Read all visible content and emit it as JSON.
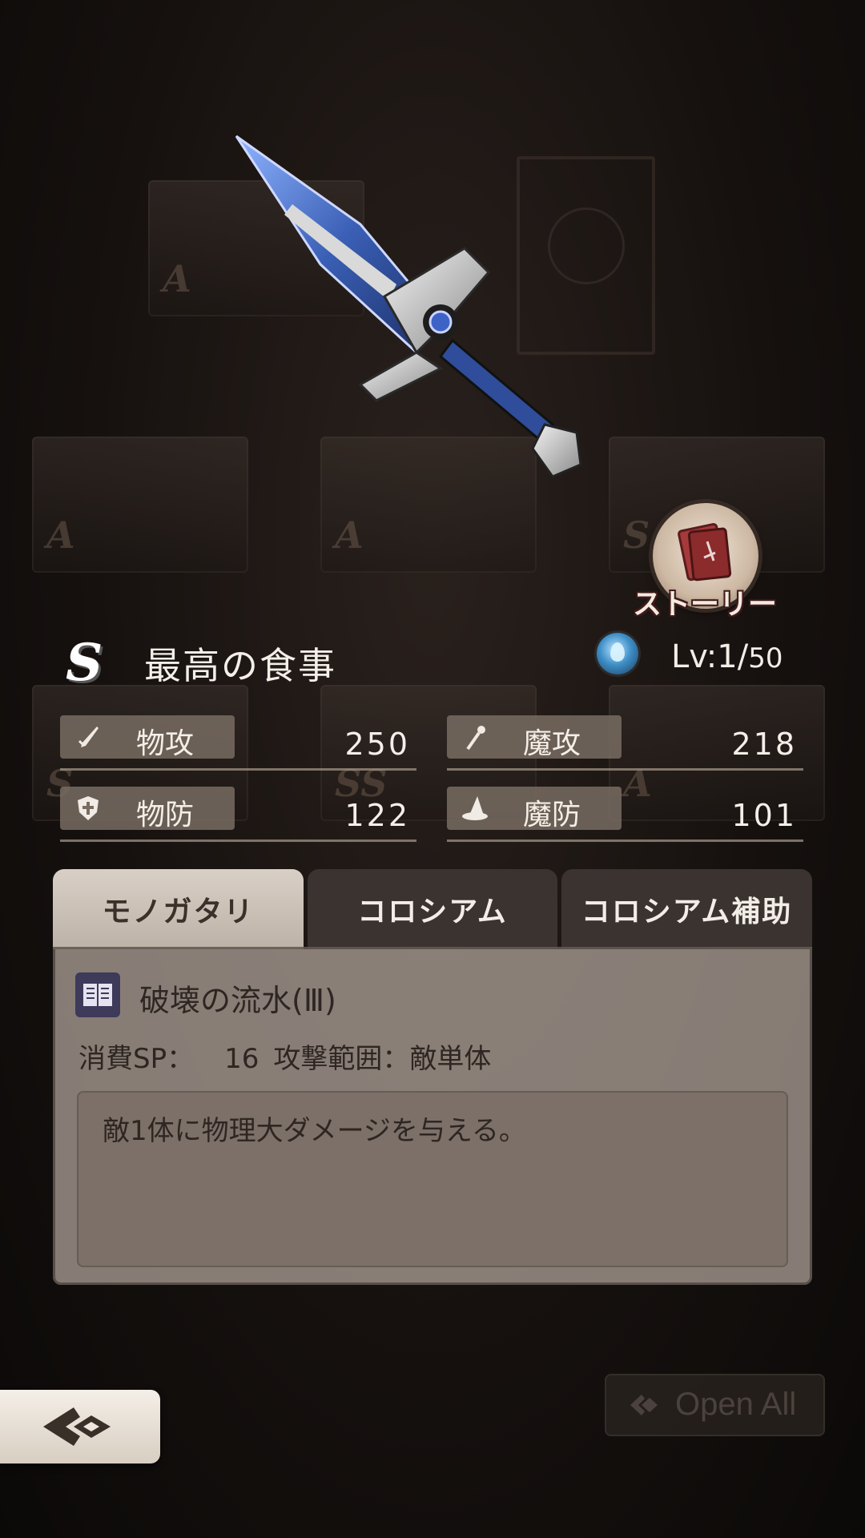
{
  "weapon": {
    "rank": "S",
    "name": "最高の食事",
    "level_current": "1",
    "level_max": "50",
    "level_prefix": "Lv:"
  },
  "story_button": {
    "label": "ストーリー"
  },
  "stats": [
    {
      "label": "物攻",
      "value": "250",
      "icon": "sword-icon"
    },
    {
      "label": "魔攻",
      "value": "218",
      "icon": "staff-icon"
    },
    {
      "label": "物防",
      "value": "122",
      "icon": "shield-icon"
    },
    {
      "label": "魔防",
      "value": "101",
      "icon": "wizard-hat-icon"
    }
  ],
  "tabs": [
    {
      "label": "モノガタリ",
      "active": true
    },
    {
      "label": "コロシアム",
      "active": false
    },
    {
      "label": "コロシアム補助",
      "active": false
    }
  ],
  "skill": {
    "name": "破壊の流水(Ⅲ)",
    "sp_label": "消費SP：",
    "sp_value": "16",
    "range_label": "攻撃範囲：敵単体",
    "description": "敵1体に物理大ダメージを与える。"
  },
  "open_all": {
    "label": "Open All"
  },
  "colors": {
    "tab_active_bg": "#d8cfc6",
    "tab_inactive_bg": "#3a3330",
    "panel_bg": "#b4a89e",
    "element_water": "#3f90c8"
  }
}
